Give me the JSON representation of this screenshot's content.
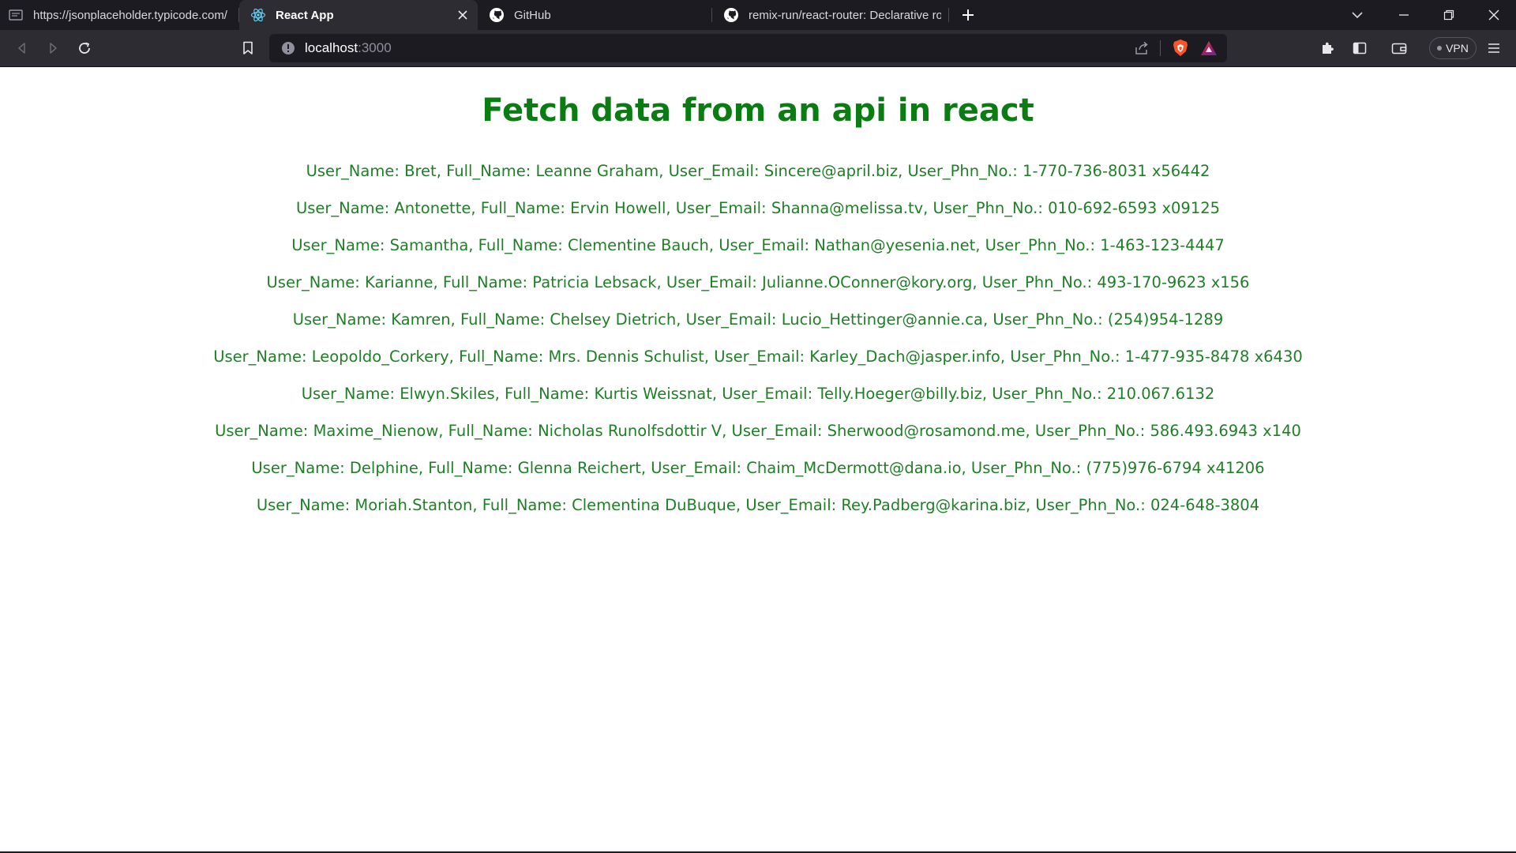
{
  "tabs": [
    {
      "title": "https://jsonplaceholder.typicode.com/",
      "icon": "document-icon"
    },
    {
      "title": "React App",
      "icon": "react-icon",
      "active": true
    },
    {
      "title": "GitHub",
      "icon": "github-icon"
    },
    {
      "title": "remix-run/react-router: Declarative rou",
      "icon": "github-icon"
    }
  ],
  "toolbar": {
    "url_host": "localhost",
    "url_port": ":3000",
    "vpn_label": "VPN"
  },
  "page": {
    "heading": "Fetch data from an api in react",
    "users": [
      "User_Name: Bret, Full_Name: Leanne Graham, User_Email: Sincere@april.biz, User_Phn_No.: 1-770-736-8031 x56442",
      "User_Name: Antonette, Full_Name: Ervin Howell, User_Email: Shanna@melissa.tv, User_Phn_No.: 010-692-6593 x09125",
      "User_Name: Samantha, Full_Name: Clementine Bauch, User_Email: Nathan@yesenia.net, User_Phn_No.: 1-463-123-4447",
      "User_Name: Karianne, Full_Name: Patricia Lebsack, User_Email: Julianne.OConner@kory.org, User_Phn_No.: 493-170-9623 x156",
      "User_Name: Kamren, Full_Name: Chelsey Dietrich, User_Email: Lucio_Hettinger@annie.ca, User_Phn_No.: (254)954-1289",
      "User_Name: Leopoldo_Corkery, Full_Name: Mrs. Dennis Schulist, User_Email: Karley_Dach@jasper.info, User_Phn_No.: 1-477-935-8478 x6430",
      "User_Name: Elwyn.Skiles, Full_Name: Kurtis Weissnat, User_Email: Telly.Hoeger@billy.biz, User_Phn_No.: 210.067.6132",
      "User_Name: Maxime_Nienow, Full_Name: Nicholas Runolfsdottir V, User_Email: Sherwood@rosamond.me, User_Phn_No.: 586.493.6943 x140",
      "User_Name: Delphine, Full_Name: Glenna Reichert, User_Email: Chaim_McDermott@dana.io, User_Phn_No.: (775)976-6794 x41206",
      "User_Name: Moriah.Stanton, Full_Name: Clementina DuBuque, User_Email: Rey.Padberg@karina.biz, User_Phn_No.: 024-648-3804"
    ]
  },
  "colors": {
    "heading": "#0a7d12",
    "text": "#1f7f26",
    "chrome_dark": "#1c1b22",
    "chrome_toolbar": "#2d2c33"
  }
}
